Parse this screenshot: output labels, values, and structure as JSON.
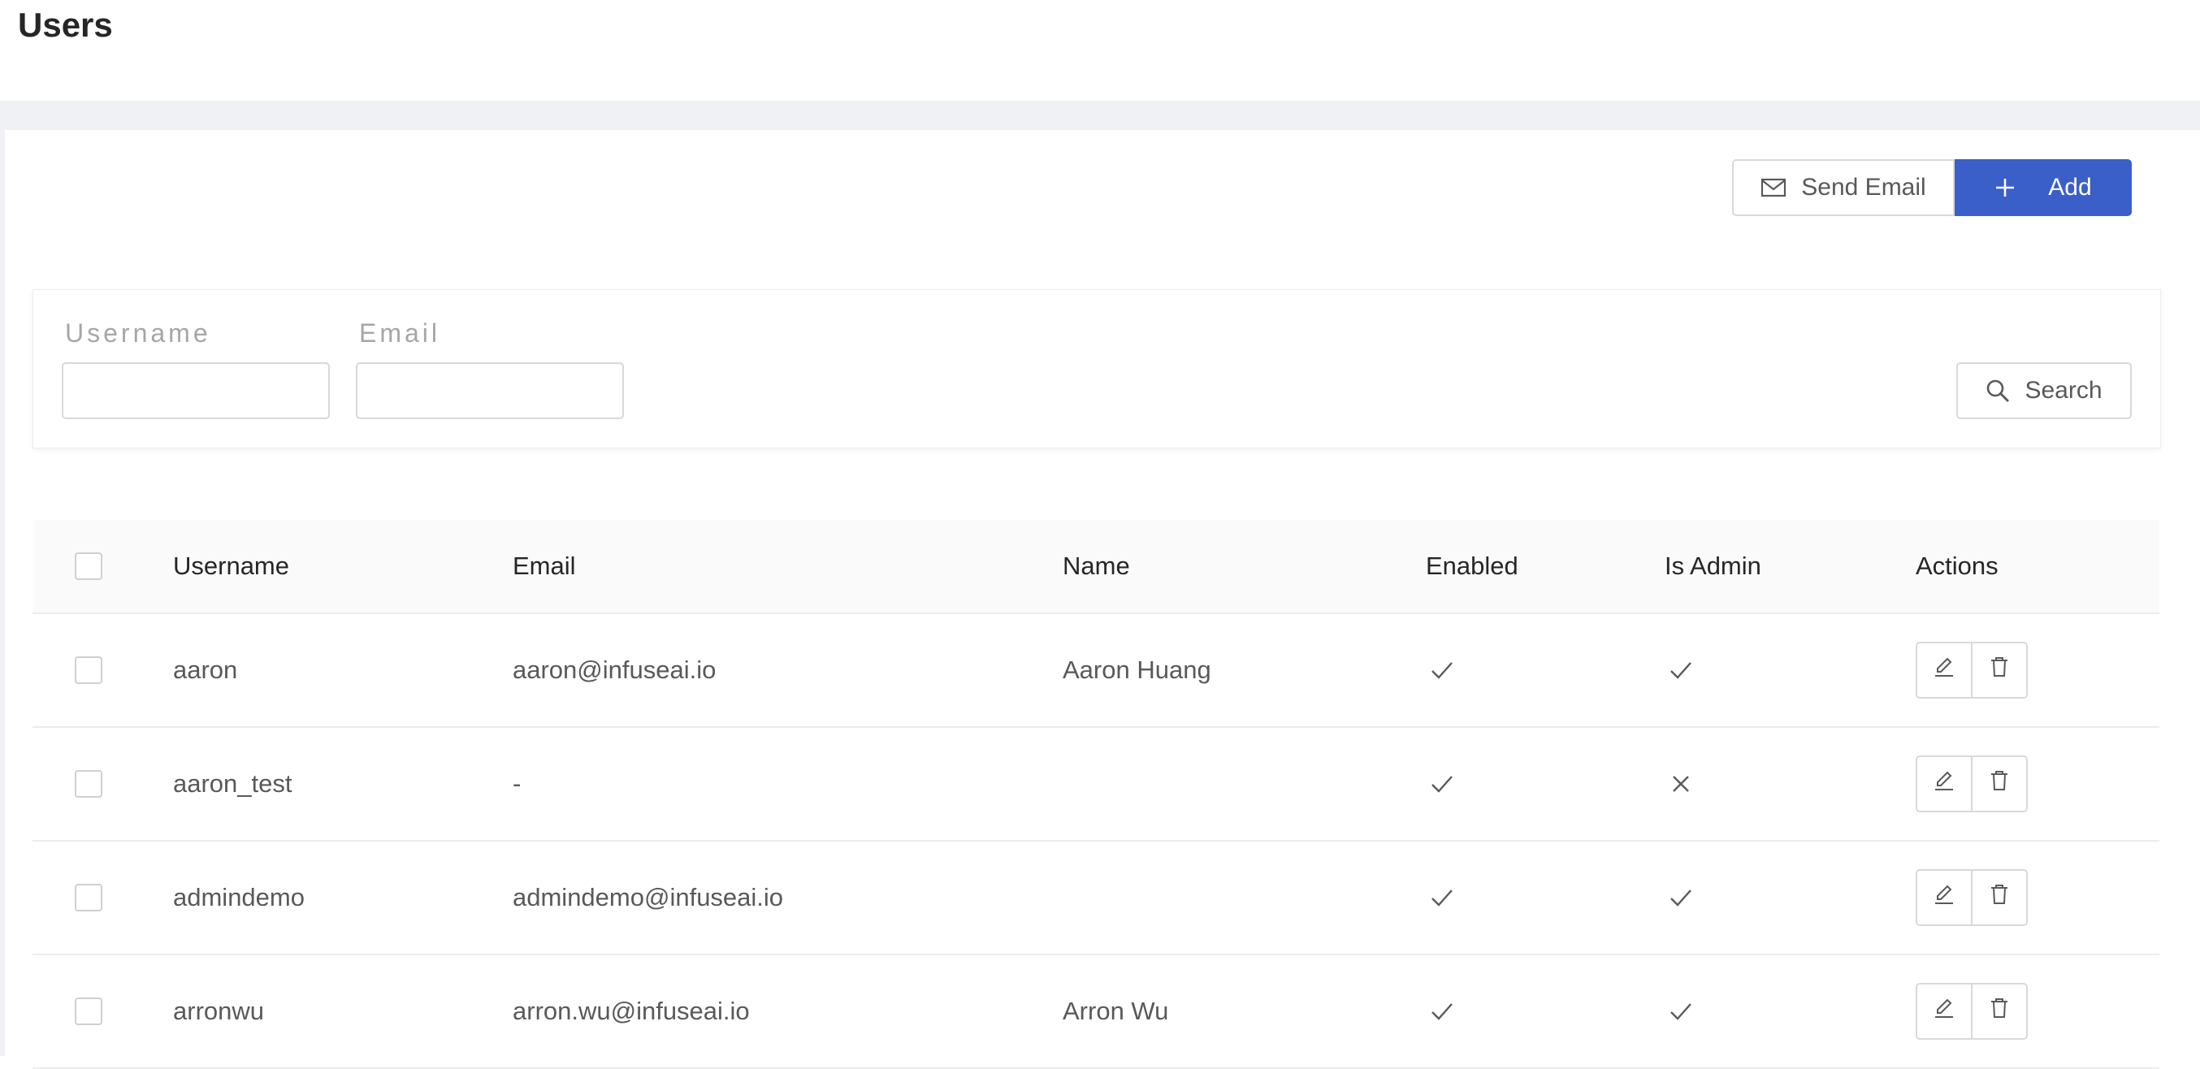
{
  "page": {
    "title": "Users"
  },
  "toolbar": {
    "send_email_label": "Send Email",
    "send_email_icon": "mail-icon",
    "add_label": "Add",
    "add_icon": "plus-icon",
    "accent_color": "#3b5fc8"
  },
  "filters": {
    "username": {
      "label": "Username",
      "value": "",
      "placeholder": ""
    },
    "email": {
      "label": "Email",
      "value": "",
      "placeholder": ""
    },
    "search_label": "Search",
    "search_icon": "search-icon"
  },
  "table": {
    "columns": [
      "Username",
      "Email",
      "Name",
      "Enabled",
      "Is Admin",
      "Actions"
    ],
    "rows": [
      {
        "username": "aaron",
        "email": "aaron@infuseai.io",
        "name": "Aaron Huang",
        "enabled": true,
        "is_admin": true
      },
      {
        "username": "aaron_test",
        "email": "-",
        "name": "",
        "enabled": true,
        "is_admin": false
      },
      {
        "username": "admindemo",
        "email": "admindemo@infuseai.io",
        "name": "",
        "enabled": true,
        "is_admin": true
      },
      {
        "username": "arronwu",
        "email": "arron.wu@infuseai.io",
        "name": "Arron Wu",
        "enabled": true,
        "is_admin": true
      }
    ],
    "action_icons": [
      "edit-icon",
      "delete-icon"
    ]
  }
}
